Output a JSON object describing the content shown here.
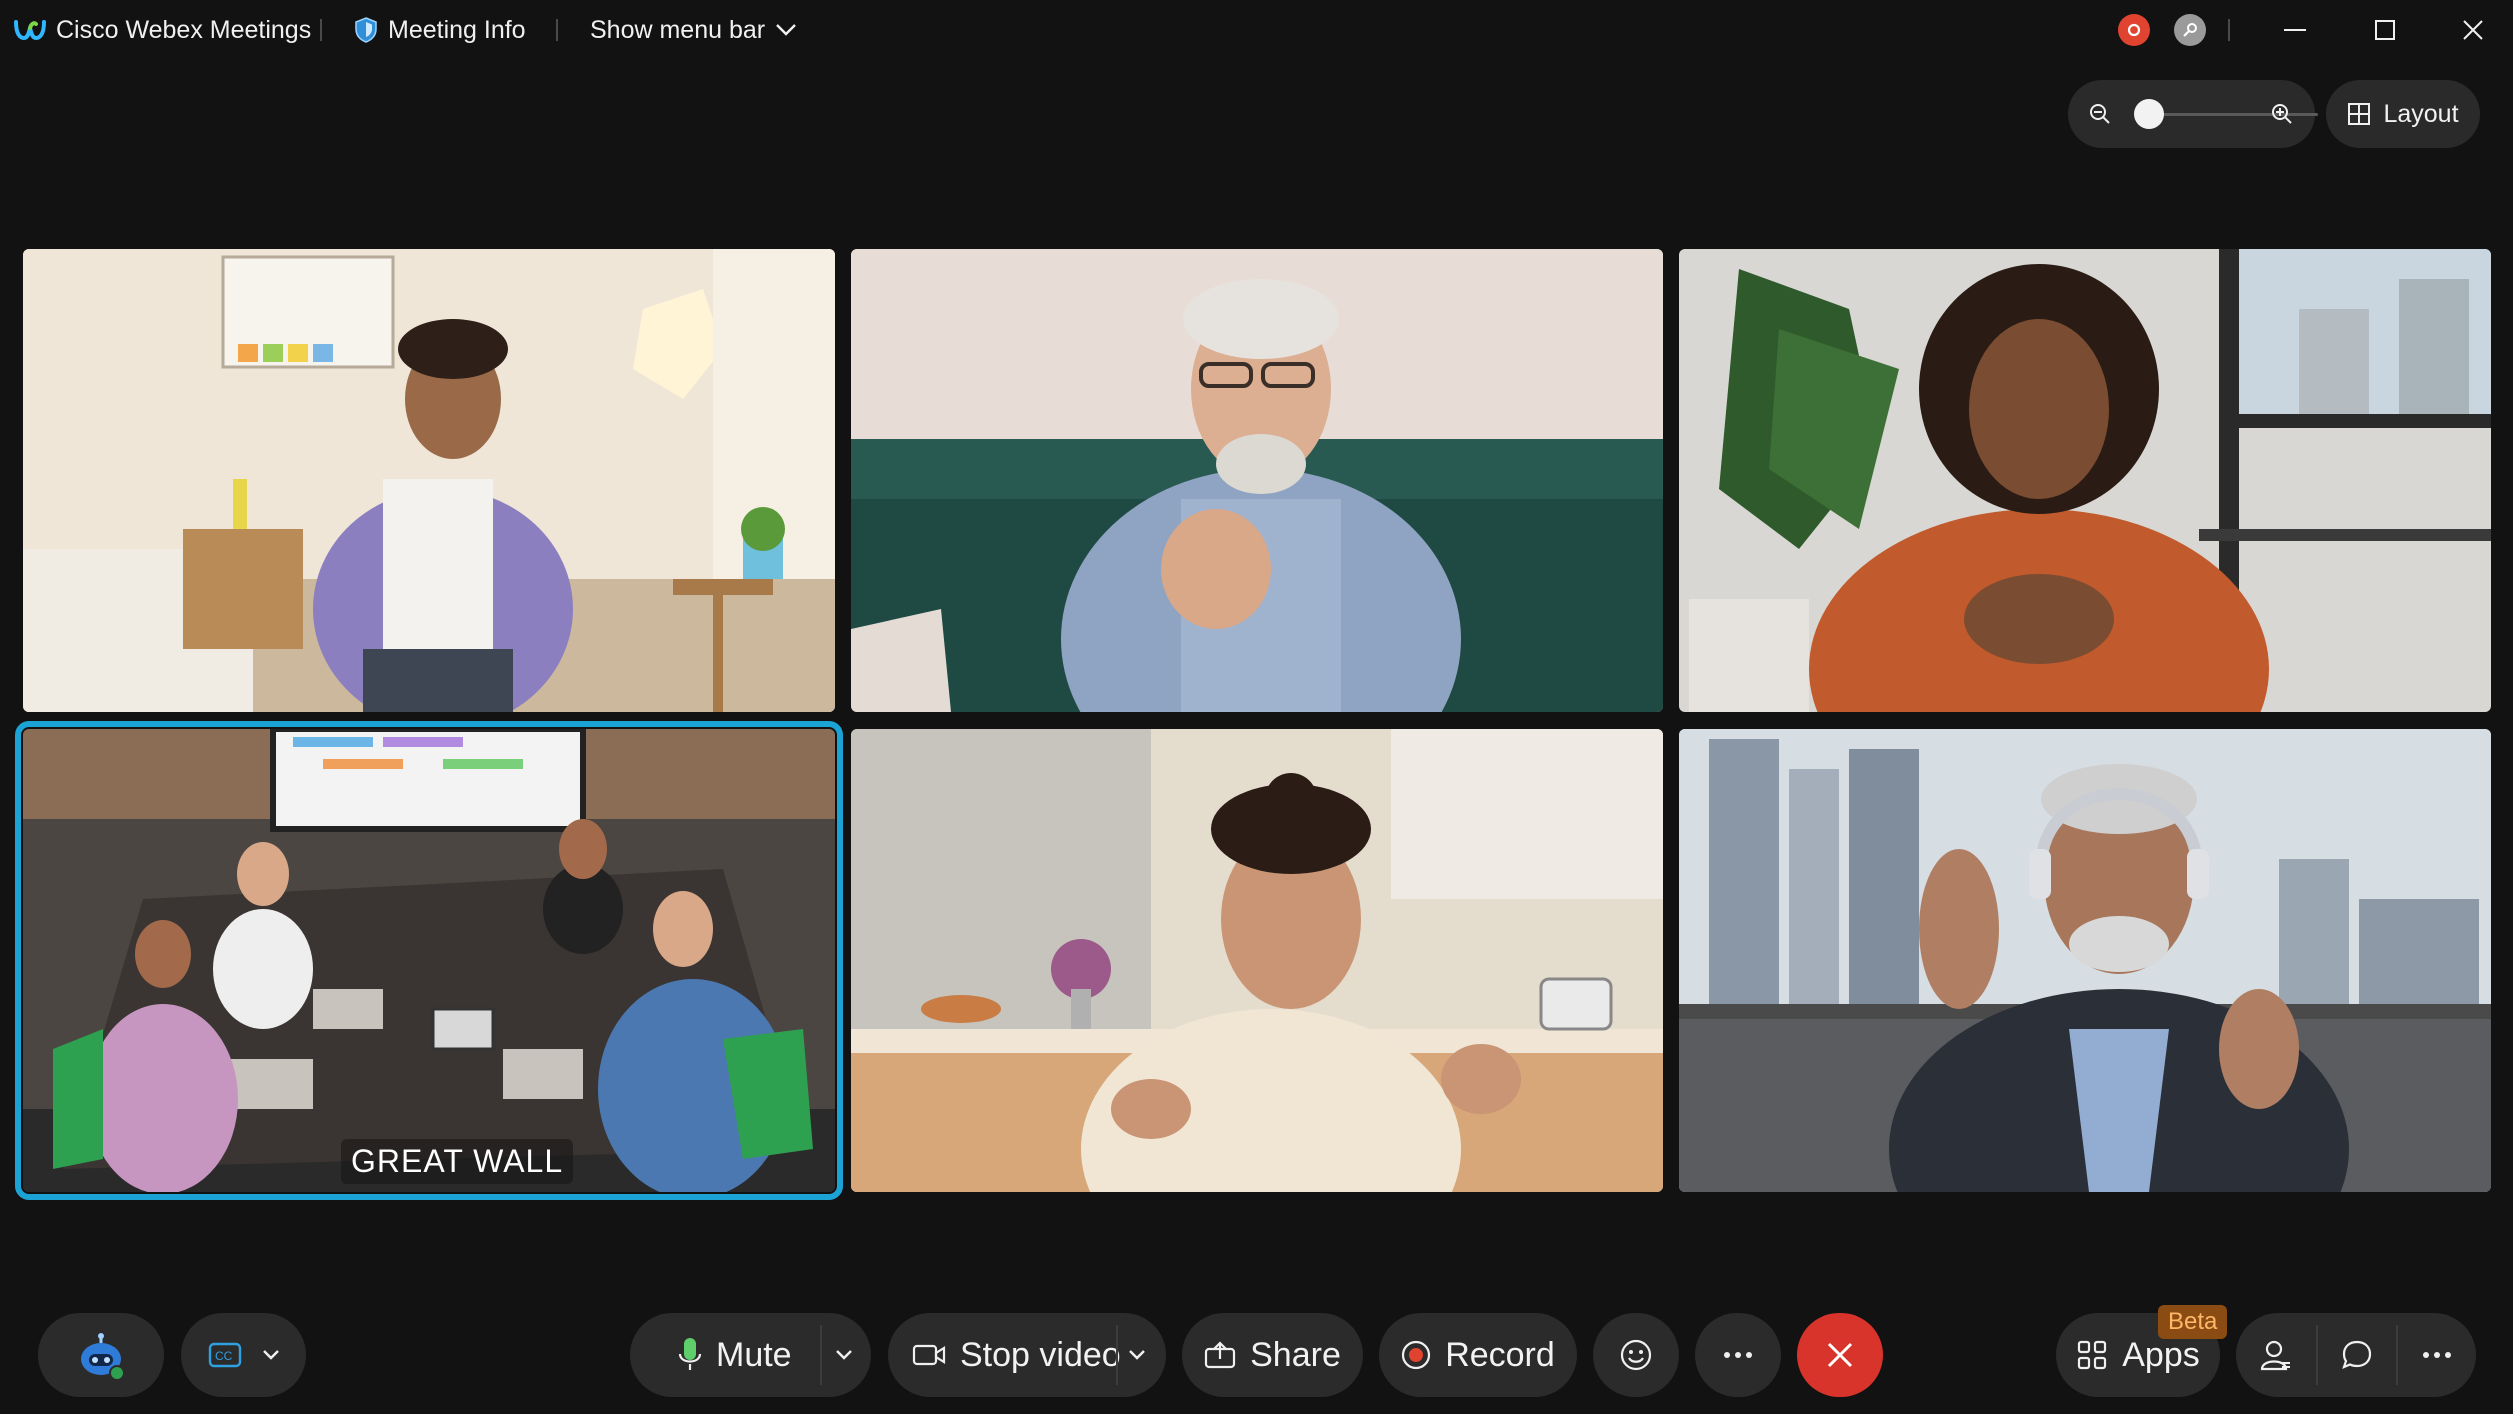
{
  "app": {
    "title": "Cisco Webex Meetings",
    "meeting_info_label": "Meeting Info",
    "show_menu_bar_label": "Show menu bar"
  },
  "window_controls": {
    "minimize_icon": "minimize-icon",
    "maximize_icon": "maximize-icon",
    "close_icon": "close-icon"
  },
  "status": {
    "recording_indicator_color": "#e0432f",
    "secure_indicator_color": "#9a9a9a"
  },
  "view": {
    "zoom_level": 0.0,
    "layout_label": "Layout"
  },
  "participants": [
    {
      "id": "p1",
      "name": "",
      "active": false
    },
    {
      "id": "p2",
      "name": "",
      "active": false
    },
    {
      "id": "p3",
      "name": "",
      "active": false
    },
    {
      "id": "p4",
      "name": "GREAT WALL",
      "active": true
    },
    {
      "id": "p5",
      "name": "",
      "active": false
    },
    {
      "id": "p6",
      "name": "",
      "active": false
    }
  ],
  "toolbar": {
    "mute_label": "Mute",
    "stop_video_label": "Stop video",
    "share_label": "Share",
    "record_label": "Record",
    "apps_label": "Apps",
    "apps_badge": "Beta"
  },
  "colors": {
    "accent": "#1ba3d6",
    "end_call": "#d9342b",
    "mic": "#5fcf6b",
    "record_icon": "#e0432f",
    "background": "#121212"
  }
}
